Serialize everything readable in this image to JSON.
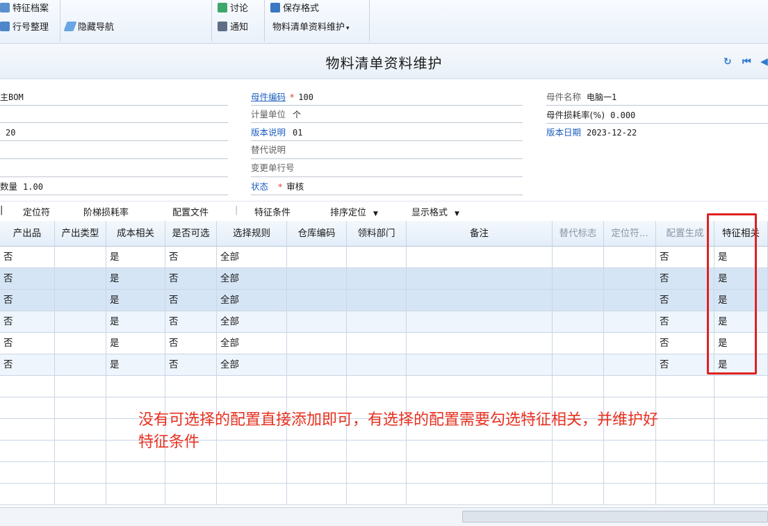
{
  "toolbar": {
    "items": [
      {
        "label": "特征档案",
        "icon": "archive-icon"
      },
      {
        "label": "行号整理",
        "icon": "reorder-icon"
      },
      {
        "label": "隐藏导航",
        "icon": "hide-nav-icon"
      },
      {
        "label": "讨论",
        "icon": "discuss-icon"
      },
      {
        "label": "通知",
        "icon": "notify-icon"
      },
      {
        "label": "保存格式",
        "icon": "save-format-icon"
      },
      {
        "label": "物料清单资料维护",
        "icon": "dropdown-caret"
      }
    ]
  },
  "page": {
    "title": "物料清单资料维护"
  },
  "form": {
    "left": {
      "bom_type": "主BOM",
      "seq": "20",
      "qty_label": "数量",
      "qty": "1.00"
    },
    "middle": {
      "parent_code_label": "母件编码",
      "parent_code": "100",
      "unit_label": "计量单位",
      "unit": "个",
      "version_desc_label": "版本说明",
      "version_desc": "01",
      "replace_desc_label": "替代说明",
      "change_no_label": "变更单行号",
      "status_label": "状态",
      "status": "审核"
    },
    "right": {
      "parent_name_label": "母件名称",
      "parent_name": "电脑一1",
      "loss_rate_label": "母件损耗率(%)",
      "loss_rate": "0.000",
      "version_date_label": "版本日期",
      "version_date": "2023-12-22"
    }
  },
  "gridbar": {
    "items": [
      "定位符",
      "阶梯损耗率",
      "配置文件",
      "特征条件",
      "排序定位",
      "显示格式"
    ]
  },
  "grid": {
    "columns": [
      "产出品",
      "产出类型",
      "成本相关",
      "是否可选",
      "选择规则",
      "仓库编码",
      "领料部门",
      "备注",
      "替代标志",
      "定位符...",
      "配置生成",
      "特征相关"
    ],
    "rows": [
      [
        "否",
        "",
        "是",
        "否",
        "全部",
        "",
        "",
        "",
        "",
        "",
        "否",
        "是"
      ],
      [
        "否",
        "",
        "是",
        "否",
        "全部",
        "",
        "",
        "",
        "",
        "",
        "否",
        "是"
      ],
      [
        "否",
        "",
        "是",
        "否",
        "全部",
        "",
        "",
        "",
        "",
        "",
        "否",
        "是"
      ],
      [
        "否",
        "",
        "是",
        "否",
        "全部",
        "",
        "",
        "",
        "",
        "",
        "否",
        "是"
      ],
      [
        "否",
        "",
        "是",
        "否",
        "全部",
        "",
        "",
        "",
        "",
        "",
        "否",
        "是"
      ],
      [
        "否",
        "",
        "是",
        "否",
        "全部",
        "",
        "",
        "",
        "",
        "",
        "否",
        "是"
      ]
    ]
  },
  "annotation": {
    "line1": "没有可选择的配置直接添加即可，有选择的配置需要勾选特征相关，并维护好",
    "line2": "特征条件"
  },
  "colors": {
    "accent": "#1e5fc0",
    "annotation": "#e8301f",
    "selected_row": "#d6e5f6"
  }
}
